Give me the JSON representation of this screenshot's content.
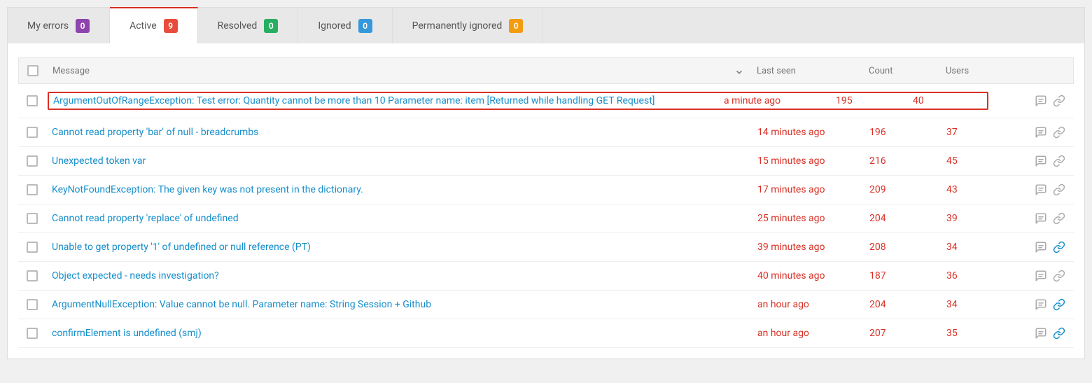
{
  "tabs": [
    {
      "label": "My errors",
      "count": "0",
      "badgeColor": "purple",
      "active": false
    },
    {
      "label": "Active",
      "count": "9",
      "badgeColor": "red",
      "active": true
    },
    {
      "label": "Resolved",
      "count": "0",
      "badgeColor": "green",
      "active": false
    },
    {
      "label": "Ignored",
      "count": "0",
      "badgeColor": "blue",
      "active": false
    },
    {
      "label": "Permanently ignored",
      "count": "0",
      "badgeColor": "yellow",
      "active": false
    }
  ],
  "headers": {
    "message": "Message",
    "lastseen": "Last seen",
    "count": "Count",
    "users": "Users"
  },
  "rows": [
    {
      "message": "ArgumentOutOfRangeException: Test error: Quantity cannot be more than 10 Parameter name: item [Returned while handling GET Request]",
      "lastseen": "a minute ago",
      "count": "195",
      "users": "40",
      "highlighted": true,
      "linkBlue": false
    },
    {
      "message": "Cannot read property 'bar' of null - breadcrumbs",
      "lastseen": "14 minutes ago",
      "count": "196",
      "users": "37",
      "highlighted": false,
      "linkBlue": false
    },
    {
      "message": "Unexpected token var",
      "lastseen": "15 minutes ago",
      "count": "216",
      "users": "45",
      "highlighted": false,
      "linkBlue": false
    },
    {
      "message": "KeyNotFoundException: The given key was not present in the dictionary.",
      "lastseen": "17 minutes ago",
      "count": "209",
      "users": "43",
      "highlighted": false,
      "linkBlue": false
    },
    {
      "message": "Cannot read property 'replace' of undefined",
      "lastseen": "25 minutes ago",
      "count": "204",
      "users": "39",
      "highlighted": false,
      "linkBlue": false
    },
    {
      "message": "Unable to get property '1' of undefined or null reference (PT)",
      "lastseen": "39 minutes ago",
      "count": "208",
      "users": "34",
      "highlighted": false,
      "linkBlue": true
    },
    {
      "message": "Object expected - needs investigation?",
      "lastseen": "40 minutes ago",
      "count": "187",
      "users": "36",
      "highlighted": false,
      "linkBlue": false
    },
    {
      "message": "ArgumentNullException: Value cannot be null. Parameter name: String Session + Github",
      "lastseen": "an hour ago",
      "count": "204",
      "users": "34",
      "highlighted": false,
      "linkBlue": true
    },
    {
      "message": "confirmElement is undefined (smj)",
      "lastseen": "an hour ago",
      "count": "207",
      "users": "35",
      "highlighted": false,
      "linkBlue": true
    }
  ]
}
